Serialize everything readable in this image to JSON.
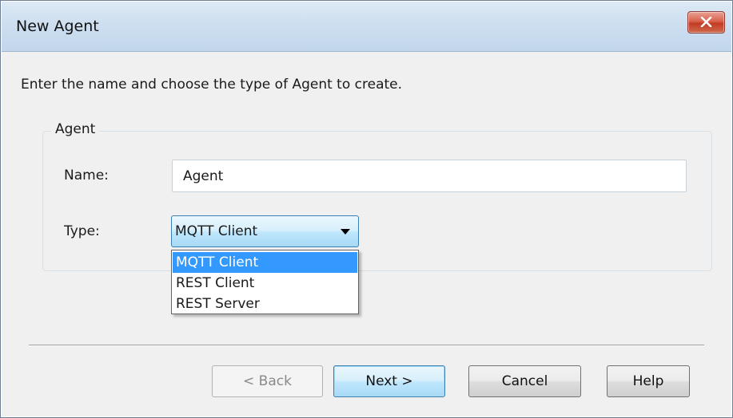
{
  "window": {
    "title": "New Agent"
  },
  "instruction": "Enter the name and choose the type of Agent to create.",
  "agent_group": {
    "label": "Agent",
    "name_label": "Name:",
    "name_value": "Agent",
    "type_label": "Type:",
    "type_selected": "MQTT Client",
    "type_options": [
      "MQTT Client",
      "REST Client",
      "REST Server"
    ]
  },
  "buttons": {
    "back": "< Back",
    "next": "Next >",
    "cancel": "Cancel",
    "help": "Help"
  },
  "icons": {
    "close": "close-icon",
    "dropdown": "chevron-down-icon"
  },
  "colors": {
    "selection": "#3399ff",
    "close_button": "#c23c24",
    "titlebar": "#cddff0"
  }
}
